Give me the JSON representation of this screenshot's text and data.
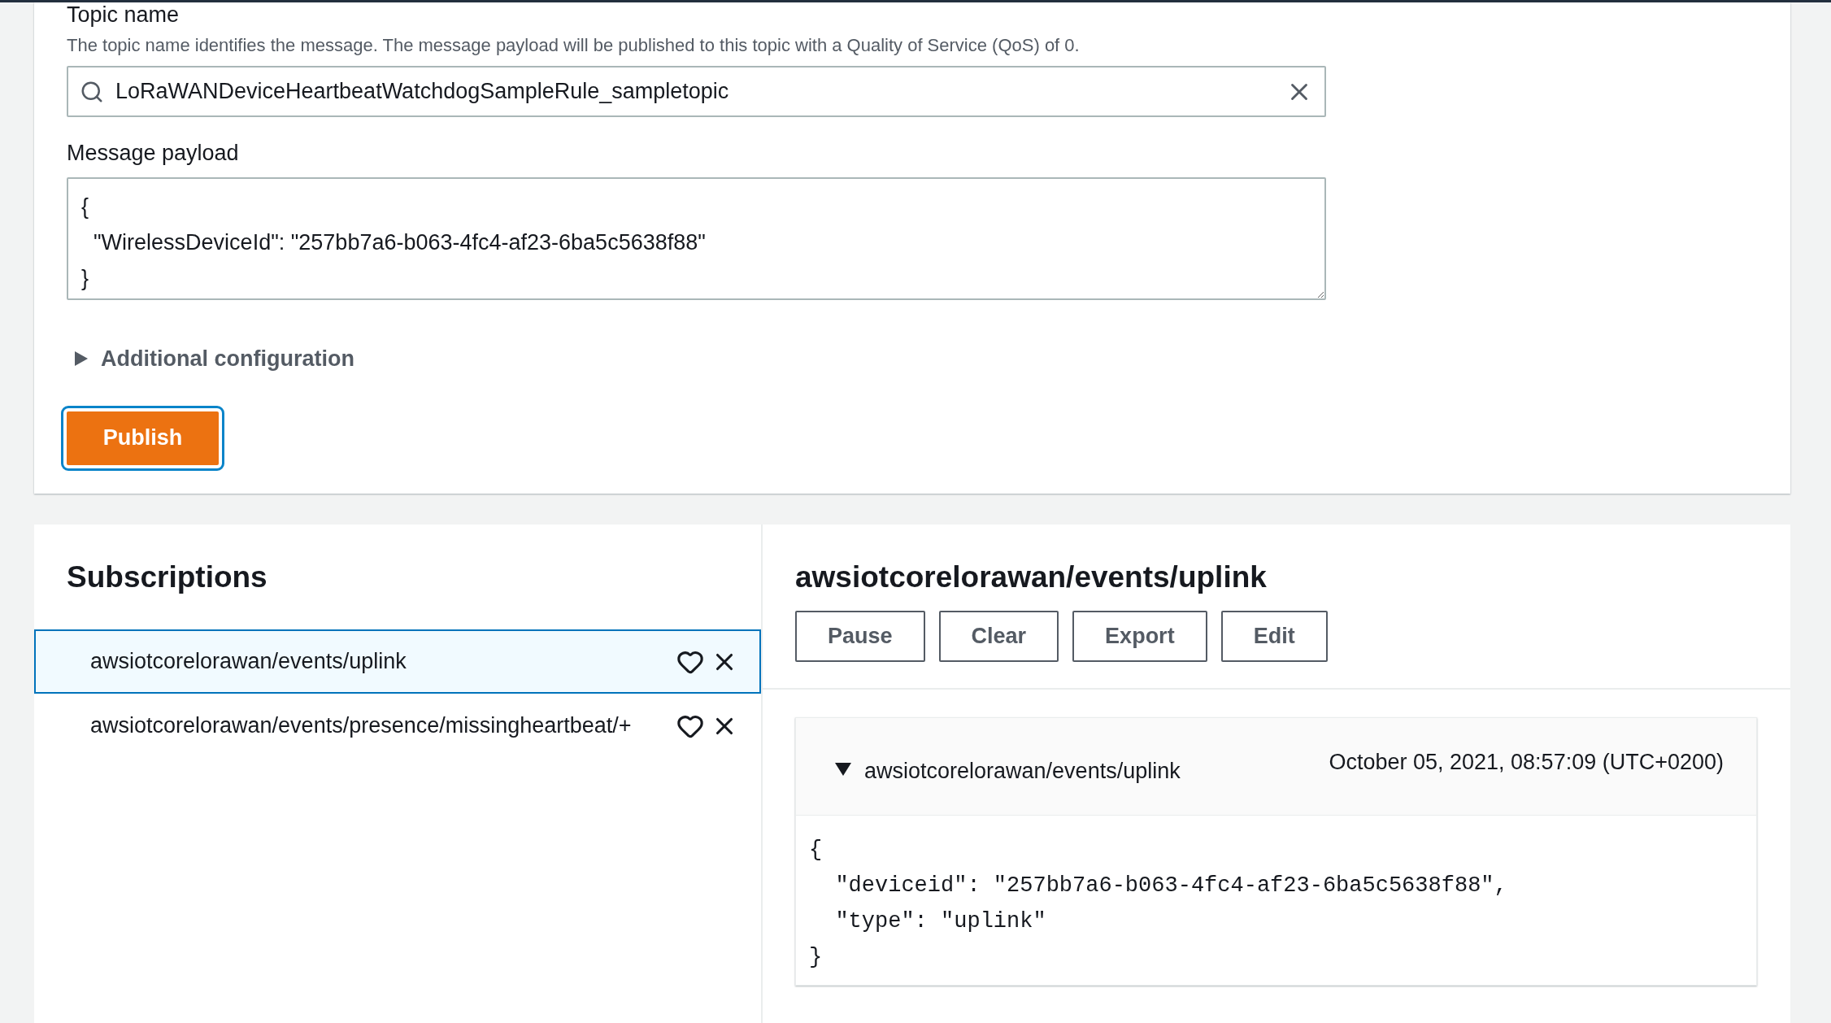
{
  "publish": {
    "topic_label": "Topic name",
    "topic_description": "The topic name identifies the message. The message payload will be published to this topic with a Quality of Service (QoS) of 0.",
    "topic_value": "LoRaWANDeviceHeartbeatWatchdogSampleRule_sampletopic",
    "payload_label": "Message payload",
    "payload_value": "{\n  \"WirelessDeviceId\": \"257bb7a6-b063-4fc4-af23-6ba5c5638f88\"\n}",
    "additional_configuration": {
      "label": "Additional configuration",
      "expanded": false
    },
    "publish_button": "Publish"
  },
  "subscriptions": {
    "title": "Subscriptions",
    "items": [
      {
        "topic": "awsiotcorelorawan/events/uplink",
        "selected": true
      },
      {
        "topic": "awsiotcorelorawan/events/presence/missingheartbeat/+",
        "selected": false
      }
    ]
  },
  "topic_view": {
    "title": "awsiotcorelorawan/events/uplink",
    "buttons": [
      "Pause",
      "Clear",
      "Export",
      "Edit"
    ],
    "messages": [
      {
        "topic": "awsiotcorelorawan/events/uplink",
        "time": "October 05, 2021, 08:57:09 (UTC+0200)",
        "expanded": true,
        "body": "{\n  \"deviceid\": \"257bb7a6-b063-4fc4-af23-6ba5c5638f88\",\n  \"type\": \"uplink\"\n}"
      }
    ]
  }
}
